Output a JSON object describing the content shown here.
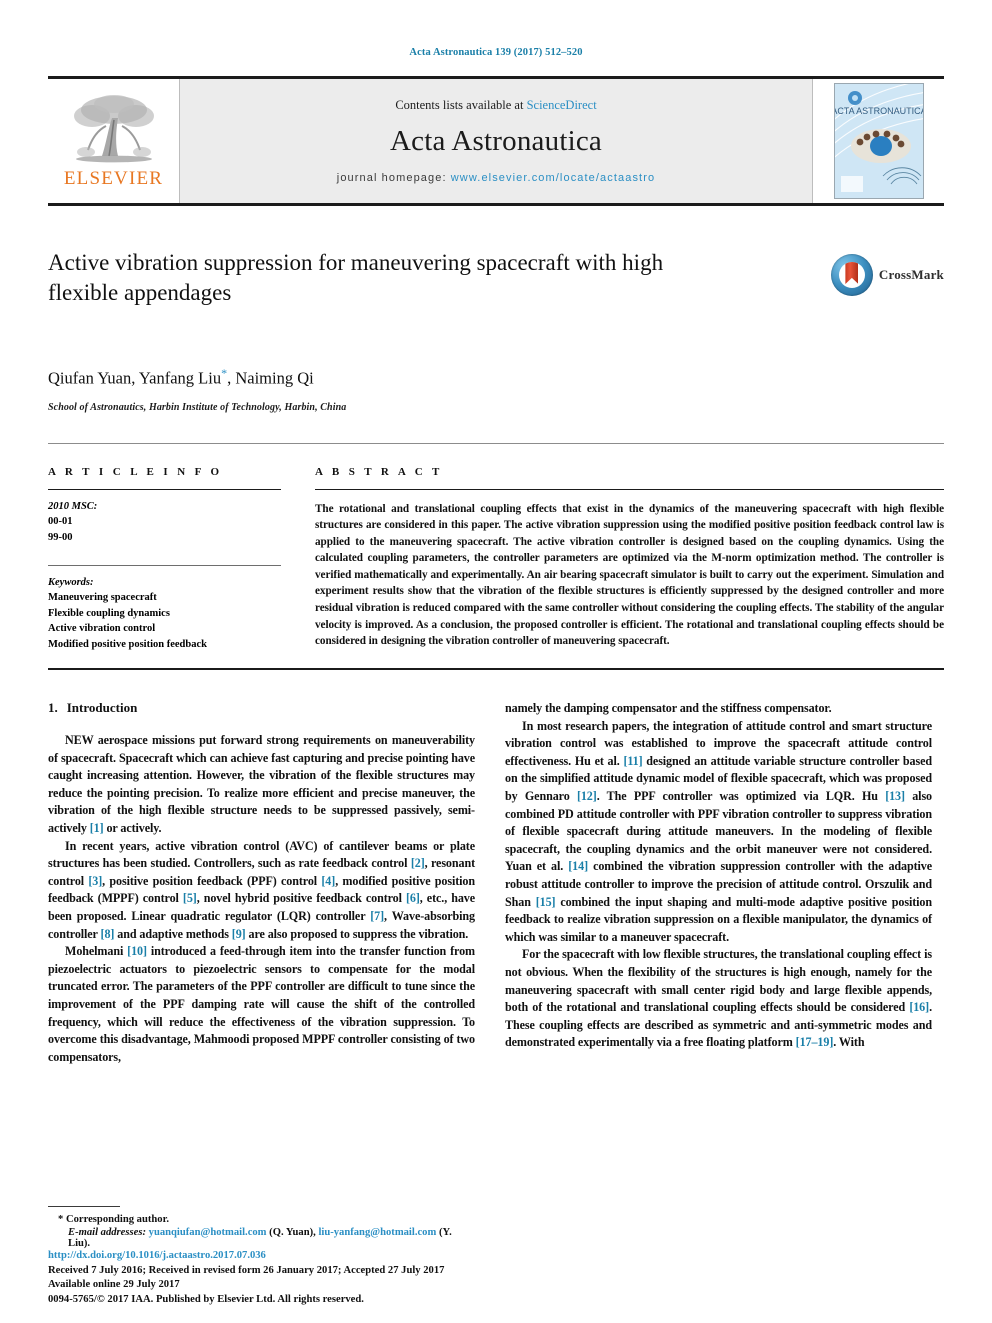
{
  "running_head": "Acta Astronautica 139 (2017) 512–520",
  "masthead": {
    "contents_prefix": "Contents lists available at ",
    "contents_link": "ScienceDirect",
    "journal_name": "Acta Astronautica",
    "homepage_label": "journal homepage:",
    "homepage_url": "www.elsevier.com/locate/actaastro",
    "publisher_wordmark": "ELSEVIER"
  },
  "article": {
    "title": "Active vibration suppression for maneuvering spacecraft with high flexible appendages",
    "authors": "Qiufan Yuan, Yanfang Liu",
    "authors_tail": ", Naiming Qi",
    "corresponding_marker": "*",
    "affiliation": "School of Astronautics, Harbin Institute of Technology, Harbin, China",
    "crossmark_label": "CrossMark"
  },
  "article_info": {
    "heading": "A R T I C L E   I N F O",
    "msc_label": "2010 MSC:",
    "msc_codes": [
      "00-01",
      "99-00"
    ],
    "keywords_label": "Keywords:",
    "keywords": [
      "Maneuvering spacecraft",
      "Flexible coupling dynamics",
      "Active vibration control",
      "Modified positive position feedback"
    ]
  },
  "abstract": {
    "heading": "A B S T R A C T",
    "text": "The rotational and translational coupling effects that exist in the dynamics of the maneuvering spacecraft with high flexible structures are considered in this paper. The active vibration suppression using the modified positive position feedback control law is applied to the maneuvering spacecraft. The active vibration controller is designed based on the coupling dynamics. Using the calculated coupling parameters, the controller parameters are optimized via the M-norm optimization method. The controller is verified mathematically and experimentally. An air bearing spacecraft simulator is built to carry out the experiment. Simulation and experiment results show that the vibration of the flexible structures is efficiently suppressed by the designed controller and more residual vibration is reduced compared with the same controller without considering the coupling effects. The stability of the angular velocity is improved. As a conclusion, the proposed controller is efficient. The rotational and translational coupling effects should be considered in designing the vibration controller of maneuvering spacecraft."
  },
  "body": {
    "section_number": "1.",
    "section_title": "Introduction",
    "left_paragraphs": [
      "NEW aerospace missions put forward strong requirements on maneuverability of spacecraft. Spacecraft which can achieve fast capturing and precise pointing have caught increasing attention. However, the vibration of the flexible structures may reduce the pointing precision. To realize more efficient and precise maneuver, the vibration of the high flexible structure needs to be suppressed passively, semi-actively [1] or actively.",
      "In recent years, active vibration control (AVC) of cantilever beams or plate structures has been studied. Controllers, such as rate feedback control [2], resonant control [3], positive position feedback (PPF) control [4], modified positive position feedback (MPPF) control [5], novel hybrid positive feedback control [6], etc., have been proposed. Linear quadratic regulator (LQR) controller [7], Wave-absorbing controller [8] and adaptive methods [9] are also proposed to suppress the vibration.",
      "Mohelmani [10] introduced a feed-through item into the transfer function from piezoelectric actuators to piezoelectric sensors to compensate for the modal truncated error. The parameters of the PPF controller are difficult to tune since the improvement of the PPF damping rate will cause the shift of the controlled frequency, which will reduce the effectiveness of the vibration suppression. To overcome this disadvantage, Mahmoodi proposed MPPF controller consisting of two compensators,"
    ],
    "right_paragraphs": [
      "namely the damping compensator and the stiffness compensator.",
      "In most research papers, the integration of attitude control and smart structure vibration control was established to improve the spacecraft attitude control effectiveness. Hu et al. [11] designed an attitude variable structure controller based on the simplified attitude dynamic model of flexible spacecraft, which was proposed by Gennaro [12]. The PPF controller was optimized via LQR. Hu [13] also combined PD attitude controller with PPF vibration controller to suppress vibration of flexible spacecraft during attitude maneuvers. In the modeling of flexible spacecraft, the coupling dynamics and the orbit maneuver were not considered. Yuan et al. [14] combined the vibration suppression controller with the adaptive robust attitude controller to improve the precision of attitude control. Orszulik and Shan [15] combined the input shaping and multi-mode adaptive positive position feedback to realize vibration suppression on a flexible manipulator, the dynamics of which was similar to a maneuver spacecraft.",
      "For the spacecraft with low flexible structures, the translational coupling effect is not obvious. When the flexibility of the structures is high enough, namely for the maneuvering spacecraft with small center rigid body and large flexible appends, both of the rotational and translational coupling effects should be considered [16]. These coupling effects are described as symmetric and anti-symmetric modes and demonstrated experimentally via a free floating platform [17–19]. With"
    ],
    "right_paragraph_continues": [
      true,
      false,
      false
    ]
  },
  "footer": {
    "corresponding_author": "* Corresponding author.",
    "email_label": "E-mail addresses:",
    "email_1": "yuanqiufan@hotmail.com",
    "email_1_owner": "(Q. Yuan),",
    "email_2": "liu-yanfang@hotmail.com",
    "email_2_owner": "(Y. Liu).",
    "doi": "http://dx.doi.org/10.1016/j.actaastro.2017.07.036",
    "history": "Received 7 July 2016; Received in revised form 26 January 2017; Accepted 27 July 2017",
    "available_online": "Available online 29 July 2017",
    "copyright": "0094-5765/© 2017 IAA. Published by Elsevier Ltd. All rights reserved."
  },
  "colors": {
    "link": "#2b8fc4",
    "running_head": "#1a7fa8",
    "elsevier_orange": "#E87722",
    "reference": "#1a7fa8"
  }
}
